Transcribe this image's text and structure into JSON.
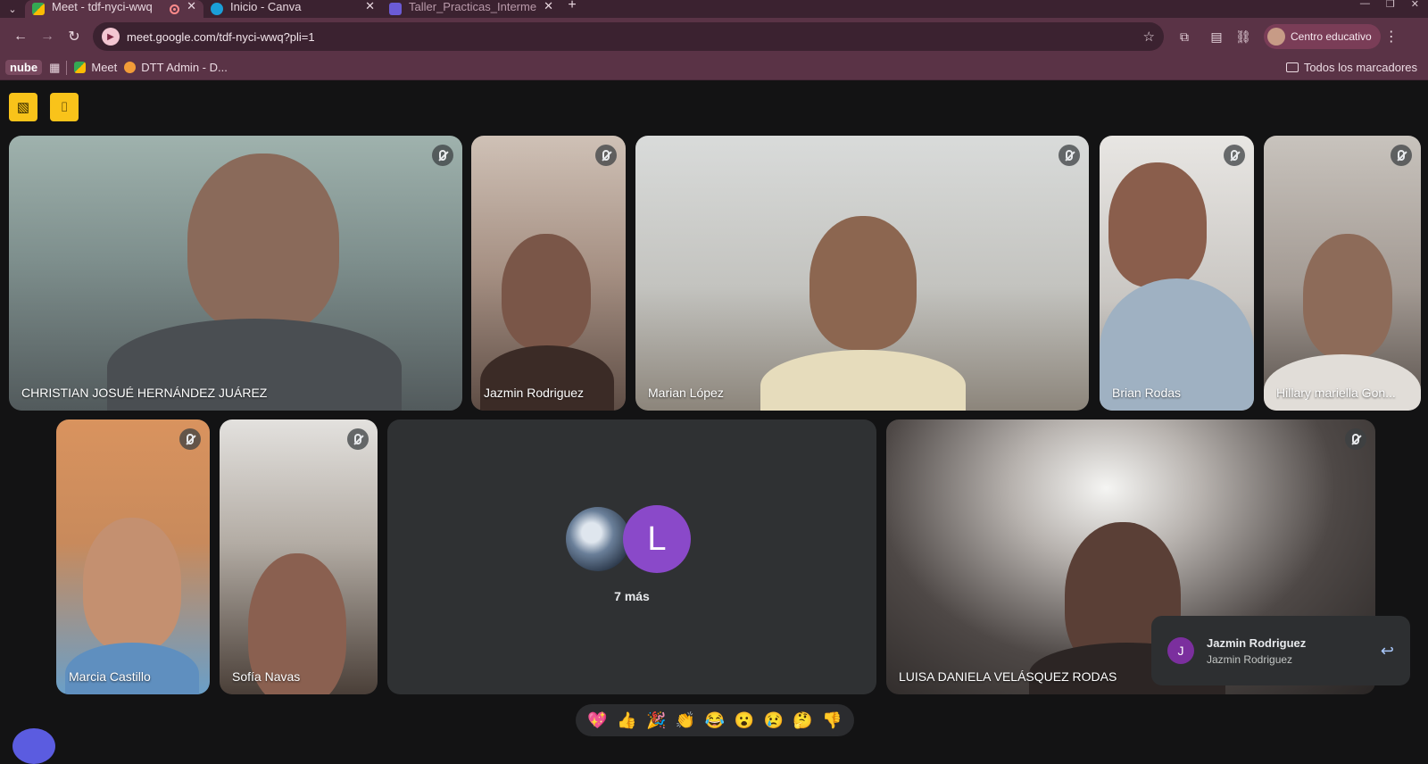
{
  "browser": {
    "tabs": [
      {
        "title": "Meet - tdf-nyci-wwq",
        "active": true
      },
      {
        "title": "Inicio - Canva",
        "active": false
      },
      {
        "title": "Taller_Practicas_Interme",
        "active": false
      }
    ],
    "url": "meet.google.com/tdf-nyci-wwq?pli=1",
    "profile_label": "Centro educativo",
    "bookmarks": {
      "folder_tag": "nube",
      "items": [
        "Meet",
        "DTT Admin - D..."
      ],
      "all_label": "Todos los marcadores"
    }
  },
  "meet": {
    "participants_row1": [
      {
        "name": "CHRISTIAN JOSUÉ HERNÁNDEZ JUÁREZ"
      },
      {
        "name": "Jazmin Rodriguez"
      },
      {
        "name": "Marian López"
      },
      {
        "name": "Brian Rodas"
      },
      {
        "name": "Hillary mariella Gon..."
      }
    ],
    "participants_row2": [
      {
        "name": "Marcia Castillo"
      },
      {
        "name": "Sofía Navas"
      },
      {
        "name": "LUISA DANIELA VELÁSQUEZ RODAS"
      }
    ],
    "more_tile": {
      "avatar_letter": "L",
      "label": "7 más"
    },
    "toast": {
      "avatar_letter": "J",
      "title": "Jazmin Rodriguez",
      "subtitle": "Jazmin Rodriguez"
    },
    "reactions": [
      "💖",
      "👍",
      "🎉",
      "👏",
      "😂",
      "😮",
      "😢",
      "🤔",
      "👎"
    ]
  }
}
